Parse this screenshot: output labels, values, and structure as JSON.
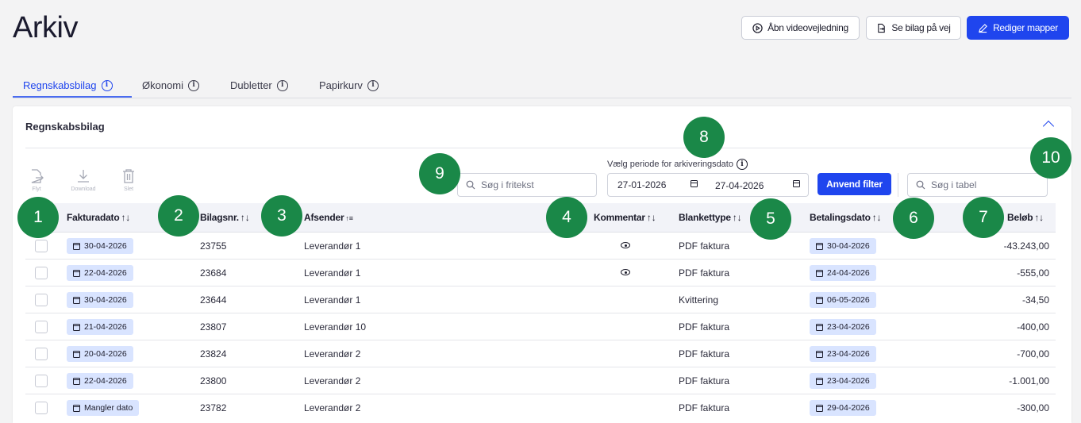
{
  "header": {
    "title": "Arkiv",
    "buttons": {
      "video": "Åbn videovejledning",
      "incoming": "Se bilag på vej",
      "edit_folders": "Rediger mapper"
    }
  },
  "tabs": [
    {
      "label": "Regnskabsbilag",
      "active": true
    },
    {
      "label": "Økonomi",
      "active": false
    },
    {
      "label": "Dubletter",
      "active": false
    },
    {
      "label": "Papirkurv",
      "active": false
    }
  ],
  "card": {
    "title": "Regnskabsbilag",
    "toolbar": {
      "move": "Flyt",
      "download": "Download",
      "delete": "Slet"
    },
    "search_freetext": {
      "placeholder": "Søg i fritekst"
    },
    "period": {
      "label": "Vælg periode for arkiveringsdato",
      "from": "27-01-2026",
      "to": "27-04-2026"
    },
    "apply_filter": "Anvend filter",
    "search_table": {
      "placeholder": "Søg i tabel"
    }
  },
  "table": {
    "columns": {
      "invoice_date": "Fakturadato",
      "voucher_no": "Bilagsnr.",
      "sender": "Afsender",
      "comment": "Kommentar",
      "form_type": "Blankettype",
      "payment_date": "Betalingsdato",
      "amount": "Beløb"
    },
    "sort_icon": "↑↓",
    "rows": [
      {
        "invoice_date": "30-04-2026",
        "voucher_no": "23755",
        "sender": "Leverandør 1",
        "comment": true,
        "form_type": "PDF faktura",
        "payment_date": "30-04-2026",
        "amount": "-43.243,00"
      },
      {
        "invoice_date": "22-04-2026",
        "voucher_no": "23684",
        "sender": "Leverandør 1",
        "comment": true,
        "form_type": "PDF faktura",
        "payment_date": "24-04-2026",
        "amount": "-555,00"
      },
      {
        "invoice_date": "30-04-2026",
        "voucher_no": "23644",
        "sender": "Leverandør 1",
        "comment": false,
        "form_type": "Kvittering",
        "payment_date": "06-05-2026",
        "amount": "-34,50"
      },
      {
        "invoice_date": "21-04-2026",
        "voucher_no": "23807",
        "sender": "Leverandør 10",
        "comment": false,
        "form_type": "PDF faktura",
        "payment_date": "23-04-2026",
        "amount": "-400,00"
      },
      {
        "invoice_date": "20-04-2026",
        "voucher_no": "23824",
        "sender": "Leverandør 2",
        "comment": false,
        "form_type": "PDF faktura",
        "payment_date": "23-04-2026",
        "amount": "-700,00"
      },
      {
        "invoice_date": "22-04-2026",
        "voucher_no": "23800",
        "sender": "Leverandør 2",
        "comment": false,
        "form_type": "PDF faktura",
        "payment_date": "23-04-2026",
        "amount": "-1.001,00"
      },
      {
        "invoice_date": "Mangler dato",
        "voucher_no": "23782",
        "sender": "Leverandør 2",
        "comment": false,
        "form_type": "PDF faktura",
        "payment_date": "29-04-2026",
        "amount": "-300,00"
      }
    ]
  },
  "annotations": [
    "1",
    "2",
    "3",
    "4",
    "5",
    "6",
    "7",
    "8",
    "9",
    "10"
  ],
  "colors": {
    "accent": "#1f45ee",
    "badge": "#1a8848",
    "date_chip": "#d9e4ff"
  }
}
